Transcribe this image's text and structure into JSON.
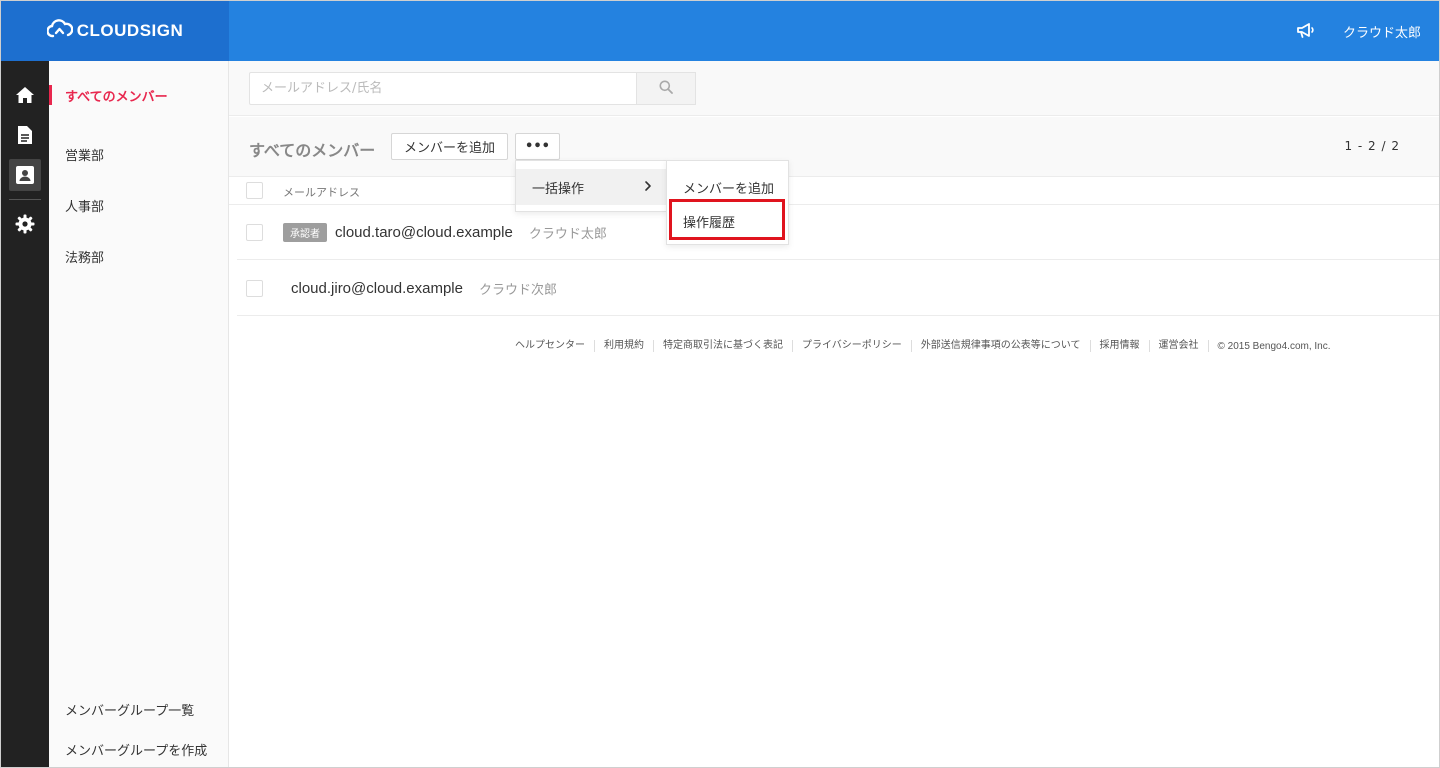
{
  "header": {
    "brand": "CLOUDSIGN",
    "user_name": "クラウド太郎",
    "brand_color": "#2482e0"
  },
  "rail": {
    "icons": [
      "home-icon",
      "document-icon",
      "contacts-icon",
      "gear-icon"
    ]
  },
  "groups": {
    "items": [
      {
        "label": "すべてのメンバー",
        "active": true
      },
      {
        "label": "営業部"
      },
      {
        "label": "人事部"
      },
      {
        "label": "法務部"
      }
    ],
    "bottom_links": [
      "メンバーグループ一覧",
      "メンバーグループを作成"
    ],
    "active_color": "#e8274e"
  },
  "search": {
    "placeholder": "メールアドレス/氏名",
    "value": ""
  },
  "toolbar": {
    "title": "すべてのメンバー",
    "add_member_label": "メンバーを追加",
    "more_label": "•••",
    "pager": "1 - 2 / 2"
  },
  "table": {
    "column_email": "メールアドレス",
    "rows": [
      {
        "badge": "承認者",
        "email": "cloud.taro@cloud.example",
        "name": "クラウド太郎"
      },
      {
        "badge": "",
        "email": "cloud.jiro@cloud.example",
        "name": "クラウド次郎"
      }
    ]
  },
  "dropdown": {
    "bulk_operation": "一括操作",
    "submenu": {
      "add_member": "メンバーを追加",
      "operation_history": "操作履歴"
    },
    "highlight_color": "#e0141e"
  },
  "footer": {
    "links": [
      "ヘルプセンター",
      "利用規約",
      "特定商取引法に基づく表記",
      "プライバシーポリシー",
      "外部送信規律事項の公表等について",
      "採用情報",
      "運営会社"
    ],
    "copyright": "© 2015 Bengo4.com, Inc."
  }
}
